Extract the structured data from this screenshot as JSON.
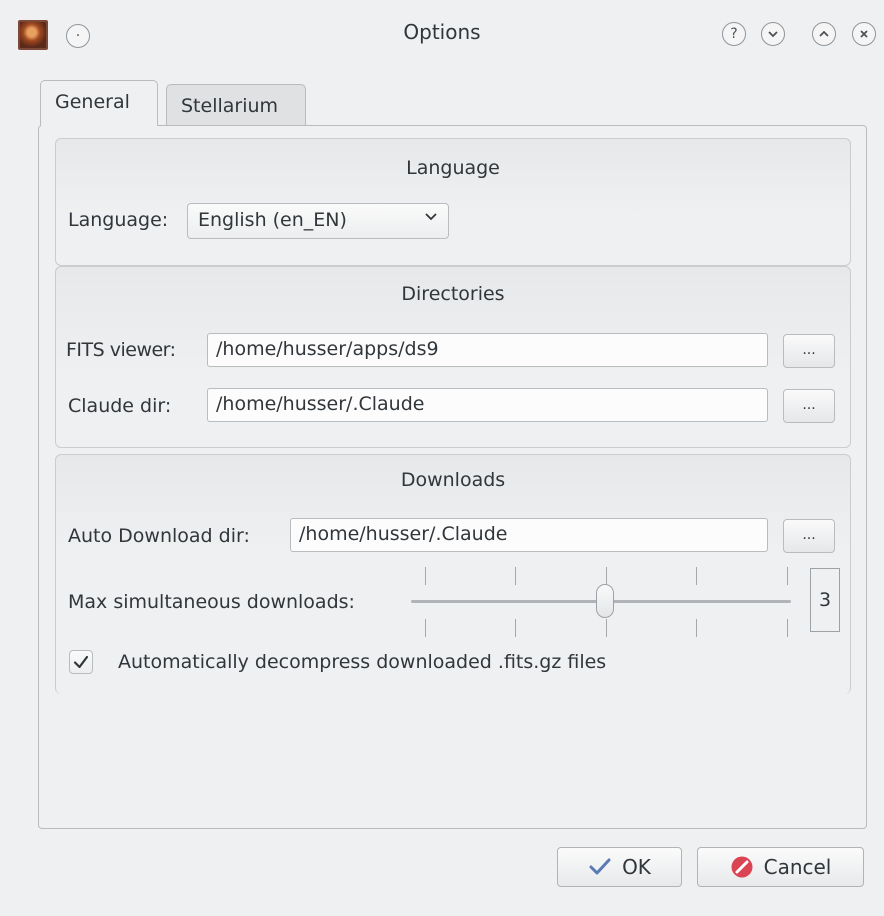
{
  "window": {
    "title": "Options"
  },
  "tabs": [
    {
      "label": "General"
    },
    {
      "label": "Stellarium"
    }
  ],
  "language_group": {
    "title": "Language",
    "label": "Language:",
    "selected": "English (en_EN)"
  },
  "directories_group": {
    "title": "Directories",
    "fits_label": "FITS viewer:",
    "fits_value": "/home/husser/apps/ds9",
    "claude_label": "Claude dir:",
    "claude_value": "/home/husser/.Claude",
    "browse_label": "..."
  },
  "downloads_group": {
    "title": "Downloads",
    "auto_label": "Auto Download dir:",
    "auto_value": "/home/husser/.Claude",
    "browse_label": "...",
    "max_label": "Max simultaneous downloads:",
    "max_value": "3",
    "decompress_label": "Automatically decompress downloaded .fits.gz files",
    "decompress_checked": true
  },
  "buttons": {
    "ok_label": "OK",
    "cancel_label": "Cancel"
  },
  "icons": {
    "help": "help-icon",
    "minimize": "minimize-icon",
    "maximize": "maximize-icon",
    "close": "close-icon",
    "ok": "checkmark-icon",
    "cancel": "cancel-icon"
  },
  "colors": {
    "cancel_icon": "#da4453",
    "ok_icon": "#5a7ab5"
  }
}
